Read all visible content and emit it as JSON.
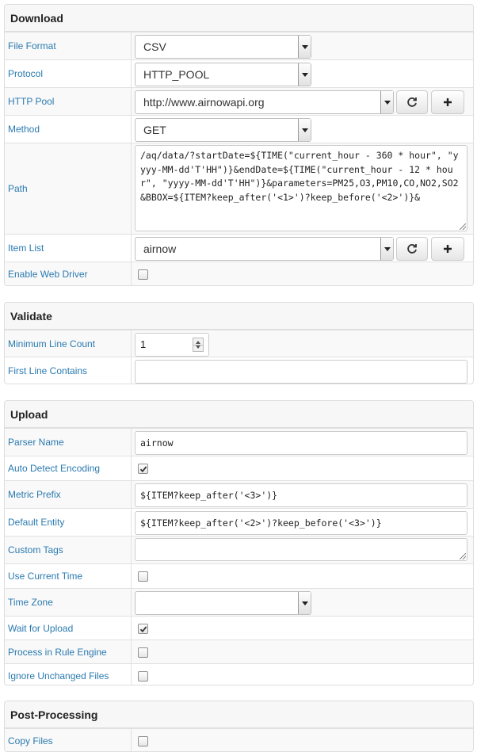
{
  "download": {
    "title": "Download",
    "file_format": {
      "label": "File Format",
      "value": "CSV"
    },
    "protocol": {
      "label": "Protocol",
      "value": "HTTP_POOL"
    },
    "http_pool": {
      "label": "HTTP Pool",
      "value": "http://www.airnowapi.org"
    },
    "method": {
      "label": "Method",
      "value": "GET"
    },
    "path": {
      "label": "Path",
      "value": "/aq/data/?startDate=${TIME(\"current_hour - 360 * hour\", \"yyyy-MM-dd'T'HH\")}&endDate=${TIME(\"current_hour - 12 * hour\", \"yyyy-MM-dd'T'HH\")}&parameters=PM25,O3,PM10,CO,NO2,SO2&BBOX=${ITEM?keep_after('<1>')?keep_before('<2>')}&"
    },
    "item_list": {
      "label": "Item List",
      "value": "airnow"
    },
    "enable_web_driver": {
      "label": "Enable Web Driver",
      "checked": false
    }
  },
  "validate": {
    "title": "Validate",
    "min_line_count": {
      "label": "Minimum Line Count",
      "value": "1"
    },
    "first_line_contains": {
      "label": "First Line Contains",
      "value": ""
    }
  },
  "upload": {
    "title": "Upload",
    "parser_name": {
      "label": "Parser Name",
      "value": "airnow"
    },
    "auto_detect_encoding": {
      "label": "Auto Detect Encoding",
      "checked": true
    },
    "metric_prefix": {
      "label": "Metric Prefix",
      "value": "${ITEM?keep_after('<3>')}"
    },
    "default_entity": {
      "label": "Default Entity",
      "value": "${ITEM?keep_after('<2>')?keep_before('<3>')}"
    },
    "custom_tags": {
      "label": "Custom Tags",
      "value": ""
    },
    "use_current_time": {
      "label": "Use Current Time",
      "checked": false
    },
    "time_zone": {
      "label": "Time Zone",
      "value": ""
    },
    "wait_for_upload": {
      "label": "Wait for Upload",
      "checked": true
    },
    "process_in_rule_engine": {
      "label": "Process in Rule Engine",
      "checked": false
    },
    "ignore_unchanged_files": {
      "label": "Ignore Unchanged Files",
      "checked": false
    }
  },
  "post_processing": {
    "title": "Post-Processing",
    "copy_files": {
      "label": "Copy Files",
      "checked": false
    }
  },
  "icons": {
    "refresh": "refresh-icon",
    "add": "plus-icon",
    "check": "check-icon"
  },
  "colors": {
    "label_link": "#2a7ab0",
    "row_shade": "#f9f9f9",
    "border": "#dddddd"
  }
}
